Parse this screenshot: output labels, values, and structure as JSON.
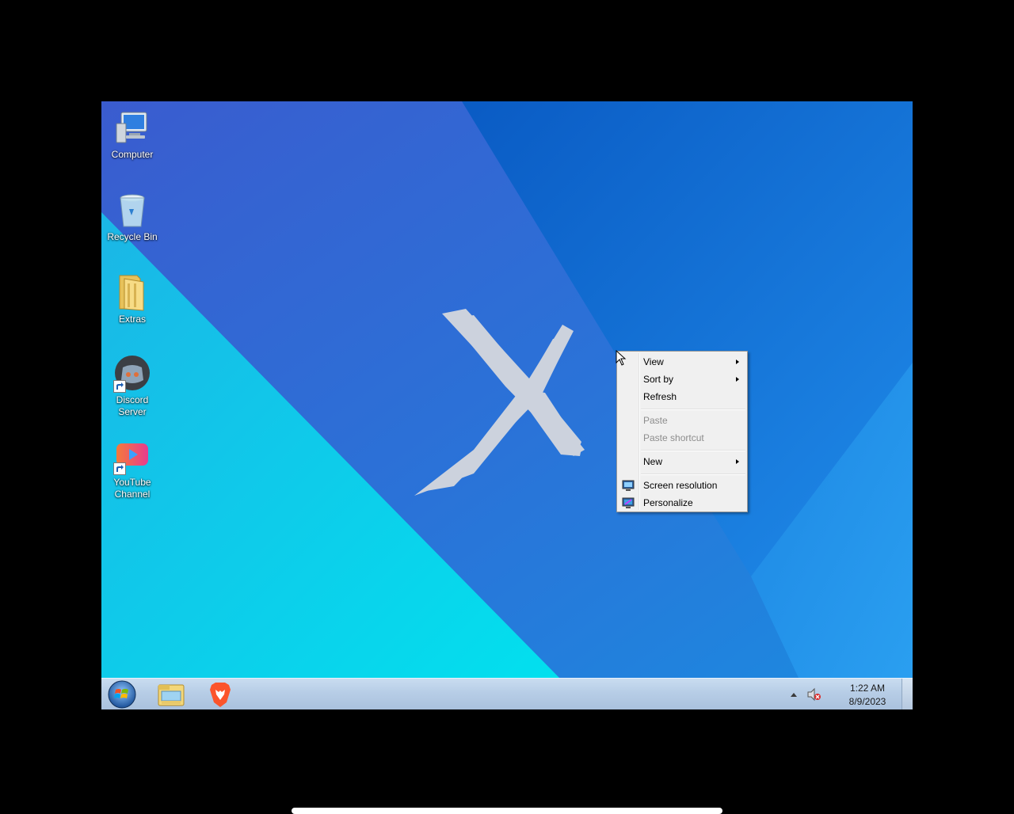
{
  "desktop": {
    "icons": [
      {
        "label": "Computer",
        "icon": "computer-icon"
      },
      {
        "label": "Recycle Bin",
        "icon": "recycle-bin-icon"
      },
      {
        "label": "Extras",
        "icon": "folder-icon"
      },
      {
        "label": "Discord\nServer",
        "icon": "discord-icon"
      },
      {
        "label": "YouTube\nChannel",
        "icon": "youtube-icon"
      }
    ]
  },
  "context_menu": {
    "items": [
      {
        "label": "View",
        "has_submenu": true,
        "enabled": true
      },
      {
        "label": "Sort by",
        "has_submenu": true,
        "enabled": true
      },
      {
        "label": "Refresh",
        "has_submenu": false,
        "enabled": true
      },
      {
        "label": "Paste",
        "has_submenu": false,
        "enabled": false
      },
      {
        "label": "Paste shortcut",
        "has_submenu": false,
        "enabled": false
      },
      {
        "label": "New",
        "has_submenu": true,
        "enabled": true
      },
      {
        "label": "Screen resolution",
        "has_submenu": false,
        "enabled": true,
        "icon": "screen-resolution-icon"
      },
      {
        "label": "Personalize",
        "has_submenu": false,
        "enabled": true,
        "icon": "personalize-icon"
      }
    ]
  },
  "taskbar": {
    "pinned": [
      {
        "name": "File Explorer",
        "icon": "file-explorer-icon"
      },
      {
        "name": "Brave",
        "icon": "brave-icon"
      }
    ],
    "tray": {
      "volume_state": "muted",
      "time": "1:22 AM",
      "date": "8/9/2023"
    }
  },
  "colors": {
    "wallpaper_dark": "#2f5fd0",
    "wallpaper_mid": "#1f78d8",
    "wallpaper_cyan": "#13d3e8",
    "taskbar": "#b7cde6",
    "menu_bg": "#f0f0f0"
  }
}
